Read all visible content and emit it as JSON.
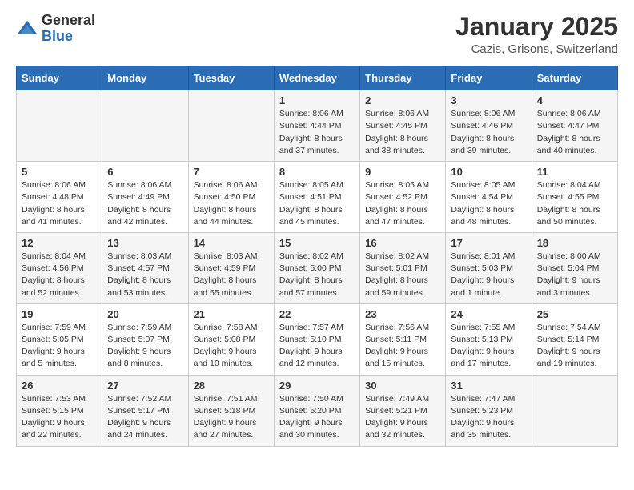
{
  "logo": {
    "general": "General",
    "blue": "Blue"
  },
  "calendar": {
    "title": "January 2025",
    "subtitle": "Cazis, Grisons, Switzerland"
  },
  "weekdays": [
    "Sunday",
    "Monday",
    "Tuesday",
    "Wednesday",
    "Thursday",
    "Friday",
    "Saturday"
  ],
  "weeks": [
    [
      {
        "day": "",
        "info": ""
      },
      {
        "day": "",
        "info": ""
      },
      {
        "day": "",
        "info": ""
      },
      {
        "day": "1",
        "info": "Sunrise: 8:06 AM\nSunset: 4:44 PM\nDaylight: 8 hours and 37 minutes."
      },
      {
        "day": "2",
        "info": "Sunrise: 8:06 AM\nSunset: 4:45 PM\nDaylight: 8 hours and 38 minutes."
      },
      {
        "day": "3",
        "info": "Sunrise: 8:06 AM\nSunset: 4:46 PM\nDaylight: 8 hours and 39 minutes."
      },
      {
        "day": "4",
        "info": "Sunrise: 8:06 AM\nSunset: 4:47 PM\nDaylight: 8 hours and 40 minutes."
      }
    ],
    [
      {
        "day": "5",
        "info": "Sunrise: 8:06 AM\nSunset: 4:48 PM\nDaylight: 8 hours and 41 minutes."
      },
      {
        "day": "6",
        "info": "Sunrise: 8:06 AM\nSunset: 4:49 PM\nDaylight: 8 hours and 42 minutes."
      },
      {
        "day": "7",
        "info": "Sunrise: 8:06 AM\nSunset: 4:50 PM\nDaylight: 8 hours and 44 minutes."
      },
      {
        "day": "8",
        "info": "Sunrise: 8:05 AM\nSunset: 4:51 PM\nDaylight: 8 hours and 45 minutes."
      },
      {
        "day": "9",
        "info": "Sunrise: 8:05 AM\nSunset: 4:52 PM\nDaylight: 8 hours and 47 minutes."
      },
      {
        "day": "10",
        "info": "Sunrise: 8:05 AM\nSunset: 4:54 PM\nDaylight: 8 hours and 48 minutes."
      },
      {
        "day": "11",
        "info": "Sunrise: 8:04 AM\nSunset: 4:55 PM\nDaylight: 8 hours and 50 minutes."
      }
    ],
    [
      {
        "day": "12",
        "info": "Sunrise: 8:04 AM\nSunset: 4:56 PM\nDaylight: 8 hours and 52 minutes."
      },
      {
        "day": "13",
        "info": "Sunrise: 8:03 AM\nSunset: 4:57 PM\nDaylight: 8 hours and 53 minutes."
      },
      {
        "day": "14",
        "info": "Sunrise: 8:03 AM\nSunset: 4:59 PM\nDaylight: 8 hours and 55 minutes."
      },
      {
        "day": "15",
        "info": "Sunrise: 8:02 AM\nSunset: 5:00 PM\nDaylight: 8 hours and 57 minutes."
      },
      {
        "day": "16",
        "info": "Sunrise: 8:02 AM\nSunset: 5:01 PM\nDaylight: 8 hours and 59 minutes."
      },
      {
        "day": "17",
        "info": "Sunrise: 8:01 AM\nSunset: 5:03 PM\nDaylight: 9 hours and 1 minute."
      },
      {
        "day": "18",
        "info": "Sunrise: 8:00 AM\nSunset: 5:04 PM\nDaylight: 9 hours and 3 minutes."
      }
    ],
    [
      {
        "day": "19",
        "info": "Sunrise: 7:59 AM\nSunset: 5:05 PM\nDaylight: 9 hours and 5 minutes."
      },
      {
        "day": "20",
        "info": "Sunrise: 7:59 AM\nSunset: 5:07 PM\nDaylight: 9 hours and 8 minutes."
      },
      {
        "day": "21",
        "info": "Sunrise: 7:58 AM\nSunset: 5:08 PM\nDaylight: 9 hours and 10 minutes."
      },
      {
        "day": "22",
        "info": "Sunrise: 7:57 AM\nSunset: 5:10 PM\nDaylight: 9 hours and 12 minutes."
      },
      {
        "day": "23",
        "info": "Sunrise: 7:56 AM\nSunset: 5:11 PM\nDaylight: 9 hours and 15 minutes."
      },
      {
        "day": "24",
        "info": "Sunrise: 7:55 AM\nSunset: 5:13 PM\nDaylight: 9 hours and 17 minutes."
      },
      {
        "day": "25",
        "info": "Sunrise: 7:54 AM\nSunset: 5:14 PM\nDaylight: 9 hours and 19 minutes."
      }
    ],
    [
      {
        "day": "26",
        "info": "Sunrise: 7:53 AM\nSunset: 5:15 PM\nDaylight: 9 hours and 22 minutes."
      },
      {
        "day": "27",
        "info": "Sunrise: 7:52 AM\nSunset: 5:17 PM\nDaylight: 9 hours and 24 minutes."
      },
      {
        "day": "28",
        "info": "Sunrise: 7:51 AM\nSunset: 5:18 PM\nDaylight: 9 hours and 27 minutes."
      },
      {
        "day": "29",
        "info": "Sunrise: 7:50 AM\nSunset: 5:20 PM\nDaylight: 9 hours and 30 minutes."
      },
      {
        "day": "30",
        "info": "Sunrise: 7:49 AM\nSunset: 5:21 PM\nDaylight: 9 hours and 32 minutes."
      },
      {
        "day": "31",
        "info": "Sunrise: 7:47 AM\nSunset: 5:23 PM\nDaylight: 9 hours and 35 minutes."
      },
      {
        "day": "",
        "info": ""
      }
    ]
  ]
}
